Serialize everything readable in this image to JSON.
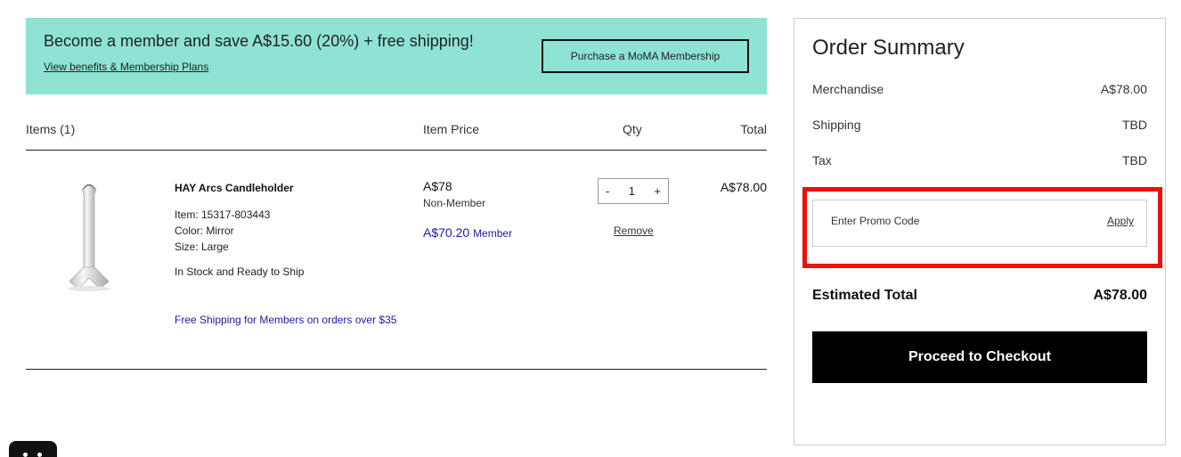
{
  "banner": {
    "title": "Become a member and save A$15.60 (20%) + free shipping!",
    "link": "View benefits & Membership Plans",
    "button": "Purchase a MoMA Membership",
    "bg_color": "#8ee3d3"
  },
  "cart": {
    "headers": {
      "items": "Items (1)",
      "price": "Item Price",
      "qty": "Qty",
      "total": "Total"
    },
    "item": {
      "name": "HAY Arcs Candleholder",
      "sku": "Item: 15317-803443",
      "color": "Color: Mirror",
      "size": "Size: Large",
      "stock": "In Stock and Ready to Ship",
      "shipping_note": "Free Shipping for Members on orders over $35",
      "price": "A$78",
      "price_label": "Non-Member",
      "member_price": "A$70.20",
      "member_label": "Member",
      "qty_minus": "-",
      "qty": "1",
      "qty_plus": "+",
      "remove": "Remove",
      "line_total": "A$78.00",
      "image_icon": "candleholder-image"
    }
  },
  "summary": {
    "title": "Order Summary",
    "rows": [
      {
        "label": "Merchandise",
        "value": "A$78.00"
      },
      {
        "label": "Shipping",
        "value": "TBD"
      },
      {
        "label": "Tax",
        "value": "TBD"
      }
    ],
    "promo_placeholder": "Enter Promo Code",
    "promo_apply": "Apply",
    "estimated_label": "Estimated Total",
    "estimated_value": "A$78.00",
    "checkout": "Proceed to Checkout",
    "highlight_color": "#ee0f10"
  },
  "chat": {
    "icon": "chat-icon"
  }
}
